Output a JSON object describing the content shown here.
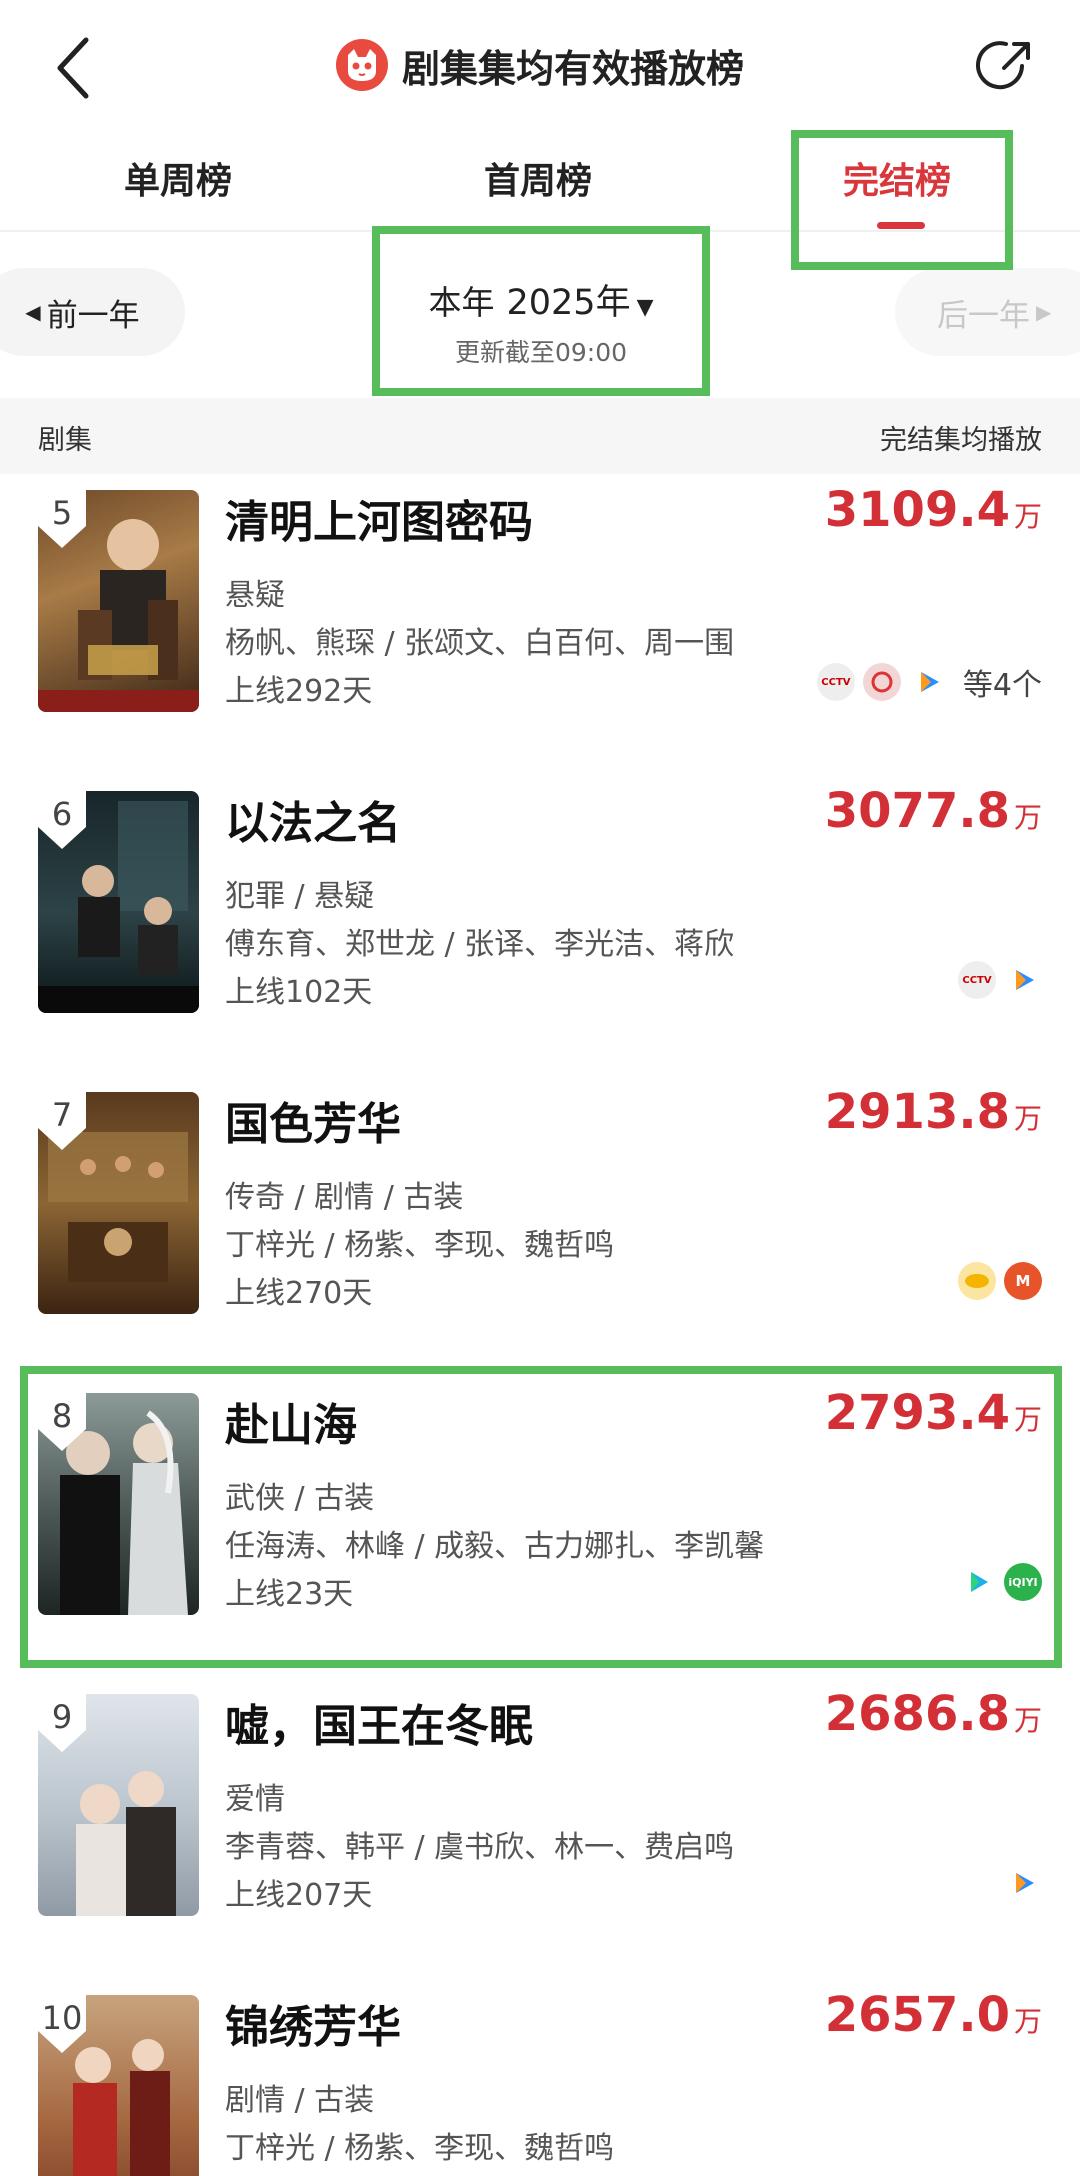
{
  "header": {
    "title": "剧集集均有效播放榜"
  },
  "tabs": [
    {
      "label": "单周榜",
      "active": false
    },
    {
      "label": "首周榜",
      "active": false
    },
    {
      "label": "完结榜",
      "active": true
    }
  ],
  "year_selector": {
    "prev_label": "前一年",
    "next_label": "后一年",
    "period_label": "本年",
    "year": "2025年",
    "updated": "更新截至09:00"
  },
  "columns": {
    "left": "剧集",
    "right": "完结集均播放"
  },
  "accent_color": "#d32f36",
  "highlight_color": "#57bd5b",
  "items": [
    {
      "rank": "5",
      "name": "清明上河图密码",
      "genre": "悬疑",
      "cast": "杨帆、熊琛 / 张颂文、白百何、周一围",
      "days": "上线292天",
      "value": "3109.4",
      "unit": "万",
      "platforms": [
        "cctv-icon",
        "circle-icon",
        "tencent-video-icon"
      ],
      "more": "等4个"
    },
    {
      "rank": "6",
      "name": "以法之名",
      "genre": "犯罪 / 悬疑",
      "cast": "傅东育、郑世龙 / 张译、李光洁、蒋欣",
      "days": "上线102天",
      "value": "3077.8",
      "unit": "万",
      "platforms": [
        "cctv-icon",
        "tencent-video-icon"
      ],
      "more": ""
    },
    {
      "rank": "7",
      "name": "国色芳华",
      "genre": "传奇 / 剧情 / 古装",
      "cast": "丁梓光 / 杨紫、李现、魏哲鸣",
      "days": "上线270天",
      "value": "2913.8",
      "unit": "万",
      "platforms": [
        "mango-icon",
        "mgtv-icon"
      ],
      "more": ""
    },
    {
      "rank": "8",
      "name": "赴山海",
      "genre": "武侠 / 古装",
      "cast": "任海涛、林峰 / 成毅、古力娜扎、李凯馨",
      "days": "上线23天",
      "value": "2793.4",
      "unit": "万",
      "platforms": [
        "youku-icon",
        "iqiyi-icon"
      ],
      "more": ""
    },
    {
      "rank": "9",
      "name": "嘘，国王在冬眠",
      "genre": "爱情",
      "cast": "李青蓉、韩平 / 虞书欣、林一、费启鸣",
      "days": "上线207天",
      "value": "2686.8",
      "unit": "万",
      "platforms": [
        "tencent-video-icon"
      ],
      "more": ""
    },
    {
      "rank": "10",
      "name": "锦绣芳华",
      "genre": "剧情 / 古装",
      "cast": "丁梓光 / 杨紫、李现、魏哲鸣",
      "days": "",
      "value": "2657.0",
      "unit": "万",
      "platforms": [],
      "more": ""
    }
  ]
}
